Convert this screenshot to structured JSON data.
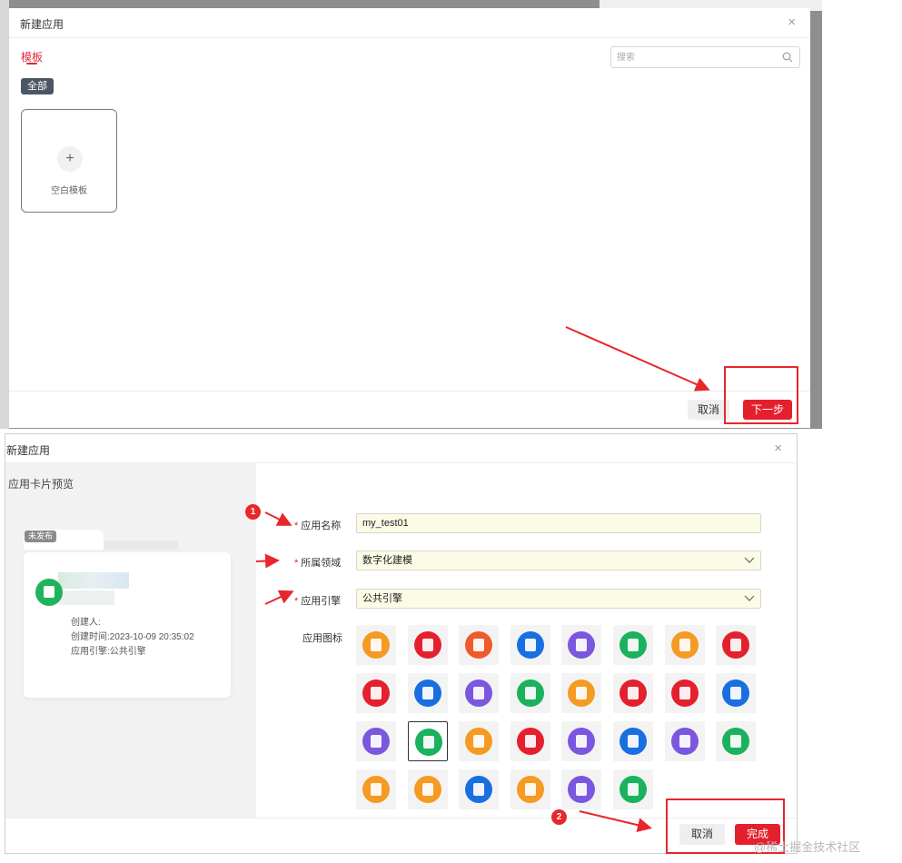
{
  "dialog1": {
    "title": "新建应用",
    "close": "×",
    "tab": "模板",
    "chip": "全部",
    "search_placeholder": "搜索",
    "card_label": "空白模板",
    "card_plus": "+",
    "cancel": "取消",
    "next": "下一步"
  },
  "dialog2": {
    "title": "新建应用",
    "close": "×",
    "preview_title": "应用卡片预览",
    "badge": "未发布",
    "creator": "创建人:",
    "created_time": "创建时间:2023-10-09 20:35:02",
    "engine_info": "应用引擎:公共引擎",
    "fields": {
      "name_label": "应用名称",
      "name_value": "my_test01",
      "domain_label": "所属领域",
      "domain_value": "数字化建模",
      "engine_label": "应用引擎",
      "engine_value": "公共引擎",
      "icon_label": "应用图标"
    },
    "cancel": "取消",
    "finish": "完成"
  },
  "markers": [
    "1",
    "2"
  ],
  "watermark": "@稀土掘金技术社区",
  "icons": [
    {
      "color": "#f59a23",
      "name": "calendar-icon"
    },
    {
      "color": "#e5202e",
      "name": "video-icon"
    },
    {
      "color": "#ef5a2a",
      "name": "edit-doc-icon"
    },
    {
      "color": "#1a6fe0",
      "name": "doc-settings-icon"
    },
    {
      "color": "#7b57e0",
      "name": "clipboard-check-icon"
    },
    {
      "color": "#1ab25c",
      "name": "folder-settings-icon"
    },
    {
      "color": "#f59a23",
      "name": "clipboard-settings-icon"
    },
    {
      "color": "#e5202e",
      "name": "box-icon"
    },
    {
      "color": "#e5202e",
      "name": "chart-doc-icon"
    },
    {
      "color": "#1a6fe0",
      "name": "clipboard-list-icon"
    },
    {
      "color": "#7b57e0",
      "name": "briefcase-icon"
    },
    {
      "color": "#1ab25c",
      "name": "book-icon"
    },
    {
      "color": "#f59a23",
      "name": "clipboard-gear-icon"
    },
    {
      "color": "#e5202e",
      "name": "package-icon"
    },
    {
      "color": "#e5202e",
      "name": "columns-icon"
    },
    {
      "color": "#1a6fe0",
      "name": "doc-lines-icon"
    },
    {
      "color": "#7b57e0",
      "name": "doc-stack-icon"
    },
    {
      "color": "#1ab25c",
      "name": "bus-icon"
    },
    {
      "color": "#f59a23",
      "name": "doc-icon"
    },
    {
      "color": "#e5202e",
      "name": "doc-edit-icon"
    },
    {
      "color": "#7b57e0",
      "name": "inbox-icon"
    },
    {
      "color": "#1a6fe0",
      "name": "doc-chart-icon"
    },
    {
      "color": "#7b57e0",
      "name": "doc-search-icon"
    },
    {
      "color": "#1ab25c",
      "name": "notes-icon"
    },
    {
      "color": "#f59a23",
      "name": "search-circle-icon"
    },
    {
      "color": "#f59a23",
      "name": "bar-chart-icon"
    },
    {
      "color": "#1a6fe0",
      "name": "list-doc-icon"
    },
    {
      "color": "#f59a23",
      "name": "bar-chart-2-icon"
    },
    {
      "color": "#7b57e0",
      "name": "line-chart-icon"
    },
    {
      "color": "#1ab25c",
      "name": "save-doc-icon"
    }
  ],
  "selected_icon_index": 17
}
